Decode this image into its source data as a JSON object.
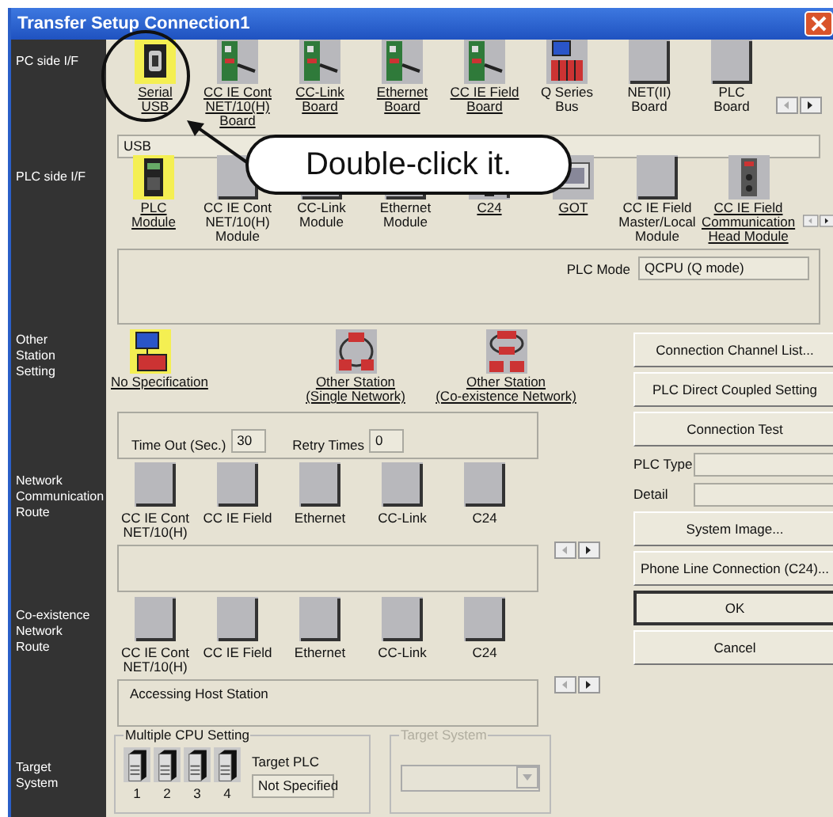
{
  "window": {
    "title": "Transfer Setup Connection1"
  },
  "callout": {
    "text": "Double-click it."
  },
  "pc_side": {
    "label": "PC side I/F",
    "field": "USB",
    "items": [
      {
        "label": "Serial\nUSB",
        "kind": "serial",
        "selected": true,
        "available": true
      },
      {
        "label": "CC IE Cont\nNET/10(H)\nBoard",
        "kind": "board",
        "selected": false,
        "available": true
      },
      {
        "label": "CC-Link\nBoard",
        "kind": "board",
        "selected": false,
        "available": true
      },
      {
        "label": "Ethernet\nBoard",
        "kind": "board",
        "selected": false,
        "available": true
      },
      {
        "label": "CC IE Field\nBoard",
        "kind": "board",
        "selected": false,
        "available": true
      },
      {
        "label": "Q Series\nBus",
        "kind": "bus",
        "selected": false,
        "available": false
      },
      {
        "label": "NET(II)\nBoard",
        "kind": "blank",
        "selected": false,
        "available": false
      },
      {
        "label": "PLC\nBoard",
        "kind": "blank",
        "selected": false,
        "available": false
      }
    ]
  },
  "plc_side": {
    "label": "PLC side I/F",
    "mode_label": "PLC Mode",
    "mode_value": "QCPU (Q mode)",
    "items": [
      {
        "label": "PLC\nModule",
        "kind": "plc",
        "selected": true,
        "available": true
      },
      {
        "label": "CC IE Cont\nNET/10(H)\nModule",
        "kind": "blank",
        "selected": false,
        "available": false
      },
      {
        "label": "CC-Link\nModule",
        "kind": "blank",
        "selected": false,
        "available": false
      },
      {
        "label": "Ethernet\nModule",
        "kind": "blank",
        "selected": false,
        "available": false
      },
      {
        "label": "C24",
        "kind": "c24",
        "selected": false,
        "available": true
      },
      {
        "label": "GOT",
        "kind": "got",
        "selected": false,
        "available": true
      },
      {
        "label": "CC IE Field\nMaster/Local\nModule",
        "kind": "blank",
        "selected": false,
        "available": false
      },
      {
        "label": "CC IE Field\nCommunication\nHead Module",
        "kind": "head",
        "selected": false,
        "available": true
      }
    ]
  },
  "other_station": {
    "label": "Other\nStation\nSetting",
    "timeout_label": "Time Out (Sec.)",
    "timeout_value": "30",
    "retry_label": "Retry Times",
    "retry_value": "0",
    "items": [
      {
        "label": "No Specification",
        "kind": "pc",
        "selected": true,
        "available": true
      },
      {
        "label": "Other Station\n(Single Network)",
        "kind": "station",
        "selected": false,
        "available": true
      },
      {
        "label": "Other Station\n(Co-existence Network)",
        "kind": "station2",
        "selected": false,
        "available": true
      }
    ]
  },
  "network_route": {
    "label": "Network\nCommunication\nRoute",
    "items": [
      {
        "label": "CC IE Cont\nNET/10(H)",
        "kind": "blank"
      },
      {
        "label": "CC IE Field",
        "kind": "blank"
      },
      {
        "label": "Ethernet",
        "kind": "blank"
      },
      {
        "label": "CC-Link",
        "kind": "blank"
      },
      {
        "label": "C24",
        "kind": "blank"
      }
    ]
  },
  "coexistence_route": {
    "label": "Co-existence\nNetwork\nRoute",
    "panel_text": "Accessing Host Station",
    "items": [
      {
        "label": "CC IE Cont\nNET/10(H)",
        "kind": "blank"
      },
      {
        "label": "CC IE Field",
        "kind": "blank"
      },
      {
        "label": "Ethernet",
        "kind": "blank"
      },
      {
        "label": "CC-Link",
        "kind": "blank"
      },
      {
        "label": "C24",
        "kind": "blank"
      }
    ]
  },
  "target": {
    "label": "Target\nSystem",
    "multiple_cpu": {
      "title": "Multiple CPU Setting",
      "cpus": [
        "1",
        "2",
        "3",
        "4"
      ],
      "target_label": "Target PLC",
      "target_value": "Not Specified"
    },
    "target_system": {
      "title": "Target System",
      "disabled": true
    }
  },
  "side_controls": [
    {
      "kind": "button",
      "label": "Connection Channel List..."
    },
    {
      "kind": "button",
      "label": "PLC Direct Coupled Setting"
    },
    {
      "kind": "button",
      "label": "Connection Test"
    },
    {
      "kind": "field",
      "label": "PLC Type"
    },
    {
      "kind": "field",
      "label": "Detail"
    },
    {
      "kind": "button",
      "label": "System Image..."
    },
    {
      "kind": "button",
      "label": "Phone Line Connection (C24)..."
    },
    {
      "kind": "button",
      "label": "OK",
      "default": true
    },
    {
      "kind": "button",
      "label": "Cancel",
      "default": false
    }
  ]
}
